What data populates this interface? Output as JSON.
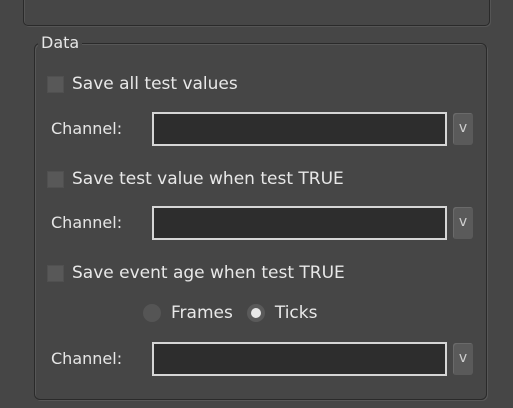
{
  "data_group": {
    "title": "Data",
    "save_all": {
      "label": "Save all test values",
      "checked": false,
      "channel_label": "Channel:",
      "channel_value": "",
      "dropdown_label": "v"
    },
    "save_when_true": {
      "label": "Save test value when test TRUE",
      "checked": false,
      "channel_label": "Channel:",
      "channel_value": "",
      "dropdown_label": "v"
    },
    "save_event_age": {
      "label": "Save event age when test TRUE",
      "checked": false,
      "units": {
        "frames_label": "Frames",
        "ticks_label": "Ticks",
        "selected": "Ticks"
      },
      "channel_label": "Channel:",
      "channel_value": "",
      "dropdown_label": "v"
    }
  }
}
